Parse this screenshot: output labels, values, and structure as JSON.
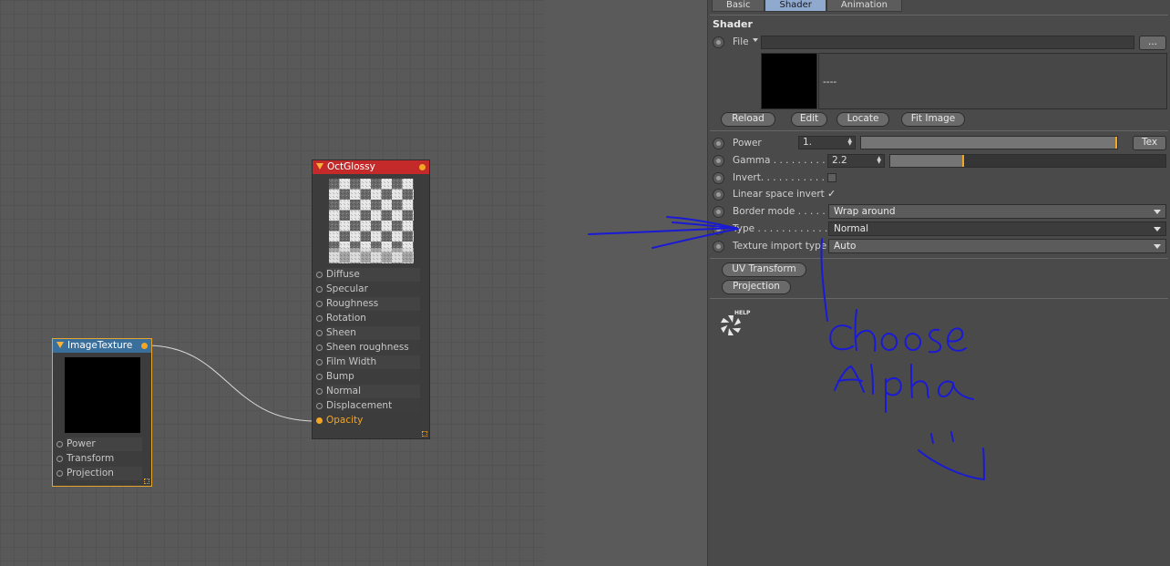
{
  "node_editor": {
    "glossy_node": {
      "title": "OctGlossy",
      "ports": [
        "Diffuse",
        "Specular",
        "Roughness",
        "Rotation",
        "Sheen",
        "Sheen roughness",
        "Film Width",
        "Bump",
        "Normal",
        "Displacement",
        "Opacity"
      ],
      "connected_port": "Opacity",
      "header_color": "#c52a2a"
    },
    "image_node": {
      "title": "ImageTexture",
      "ports": [
        "Power",
        "Transform",
        "Projection"
      ],
      "header_color": "#3a6f9b"
    }
  },
  "attributes": {
    "tabs": [
      "Basic",
      "Shader",
      "Animation"
    ],
    "active_tab": "Shader",
    "section_title": "Shader",
    "file": {
      "label": "File",
      "value": "",
      "browse_label": "..."
    },
    "preview_text": "----",
    "buttons": [
      "Reload",
      "Edit",
      "Locate",
      "Fit Image"
    ],
    "power": {
      "label": "Power",
      "value": "1.",
      "tex_label": "Tex"
    },
    "gamma": {
      "label": "Gamma . . . . . . . . . .",
      "value": "2.2"
    },
    "invert": {
      "label": "Invert. . . . . . . . . . . .",
      "checked": false
    },
    "linear_space_invert": {
      "label": "Linear space invert",
      "checked": true,
      "check_glyph": "✓"
    },
    "border_mode": {
      "label": "Border mode  . . . . .",
      "value": "Wrap around"
    },
    "type": {
      "label": "Type  . . . . . . . . . . . . .",
      "value": "Normal"
    },
    "texture_import_type": {
      "label": "Texture import type",
      "value": "Auto"
    },
    "sub_buttons": [
      "UV Transform",
      "Projection"
    ],
    "help_label": "HELP",
    "accent_color": "#f2a623"
  },
  "annotation": {
    "line1": "Choose",
    "line2": "Alpha",
    "ink_color": "#1a1ad6"
  }
}
